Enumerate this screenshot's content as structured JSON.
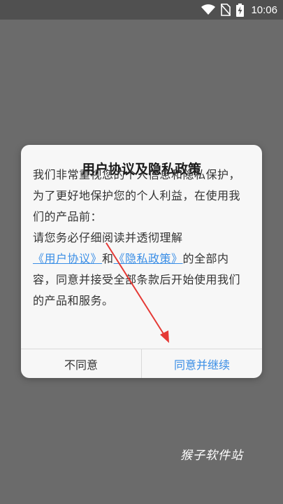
{
  "status_bar": {
    "time": "10:06",
    "icons": [
      "wifi-icon",
      "no-sim-icon",
      "battery-charging-icon"
    ]
  },
  "dialog": {
    "title": "用户协议及隐私政策",
    "intro_text": "我们非常重视您的个人信息和隐私保护，为了更好地保护您的个人利益，在使用我们的产品前：",
    "prefix_text": "请您务必仔细阅读并透彻理解",
    "user_agreement_link": "《用户协议》",
    "and_text": "和",
    "privacy_policy_link": "《隐私政策》",
    "suffix_text": "的全部内容，同意并接受全部条款后开始使用我们的产品和服务。",
    "decline_button": "不同意",
    "accept_button": "同意并继续"
  },
  "annotation": {
    "arrow_color": "#e53935"
  },
  "watermark": {
    "text": "猴子软件站"
  },
  "colors": {
    "background": "#6b6b6b",
    "status_bar": "#505050",
    "link": "#3a8ee6",
    "accept": "#3a8ee6"
  }
}
